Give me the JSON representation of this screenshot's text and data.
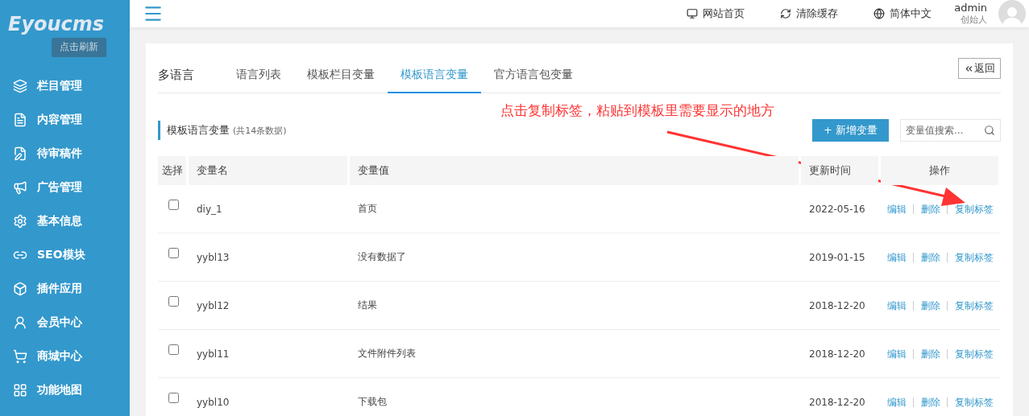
{
  "sidebar": {
    "logo": "Eyoucms",
    "refresh_button": "点击刷新",
    "items": [
      {
        "label": "栏目管理"
      },
      {
        "label": "内容管理"
      },
      {
        "label": "待审稿件"
      },
      {
        "label": "广告管理"
      },
      {
        "label": "基本信息"
      },
      {
        "label": "SEO模块"
      },
      {
        "label": "插件应用"
      },
      {
        "label": "会员中心"
      },
      {
        "label": "商城中心"
      },
      {
        "label": "功能地图"
      }
    ]
  },
  "topbar": {
    "links": [
      {
        "label": "网站首页"
      },
      {
        "label": "清除缓存"
      },
      {
        "label": "简体中文"
      }
    ],
    "user": {
      "name": "admin",
      "role": "创始人"
    }
  },
  "page": {
    "title": "多语言",
    "tabs": [
      {
        "label": "语言列表",
        "selected": false
      },
      {
        "label": "模板栏目变量",
        "selected": false
      },
      {
        "label": "模板语言变量",
        "selected": true
      },
      {
        "label": "官方语言包变量",
        "selected": false
      }
    ],
    "back_button": "返回",
    "annotation": "点击复制标签，粘贴到模板里需要显示的地方",
    "section_title": "模板语言变量",
    "section_count": "(共14条数据)",
    "add_button": "+ 新增变量",
    "search": {
      "placeholder": "变量值搜索..."
    },
    "table": {
      "columns": [
        "选择",
        "变量名",
        "变量值",
        "更新时间",
        "操作"
      ],
      "rows": [
        {
          "checked": false,
          "name": "diy_1",
          "value": "首页",
          "date": "2022-05-16",
          "actions": [
            "编辑",
            "删除",
            "复制标签"
          ]
        },
        {
          "checked": false,
          "name": "yybl13",
          "value": "没有数据了",
          "date": "2019-01-15",
          "actions": [
            "编辑",
            "删除",
            "复制标签"
          ]
        },
        {
          "checked": false,
          "name": "yybl12",
          "value": "结果",
          "date": "2018-12-20",
          "actions": [
            "编辑",
            "删除",
            "复制标签"
          ]
        },
        {
          "checked": false,
          "name": "yybl11",
          "value": "文件附件列表",
          "date": "2018-12-20",
          "actions": [
            "编辑",
            "删除",
            "复制标签"
          ]
        },
        {
          "checked": false,
          "name": "yybl10",
          "value": "下载包",
          "date": "2018-12-20",
          "actions": [
            "编辑",
            "删除",
            "复制标签"
          ]
        }
      ]
    }
  }
}
